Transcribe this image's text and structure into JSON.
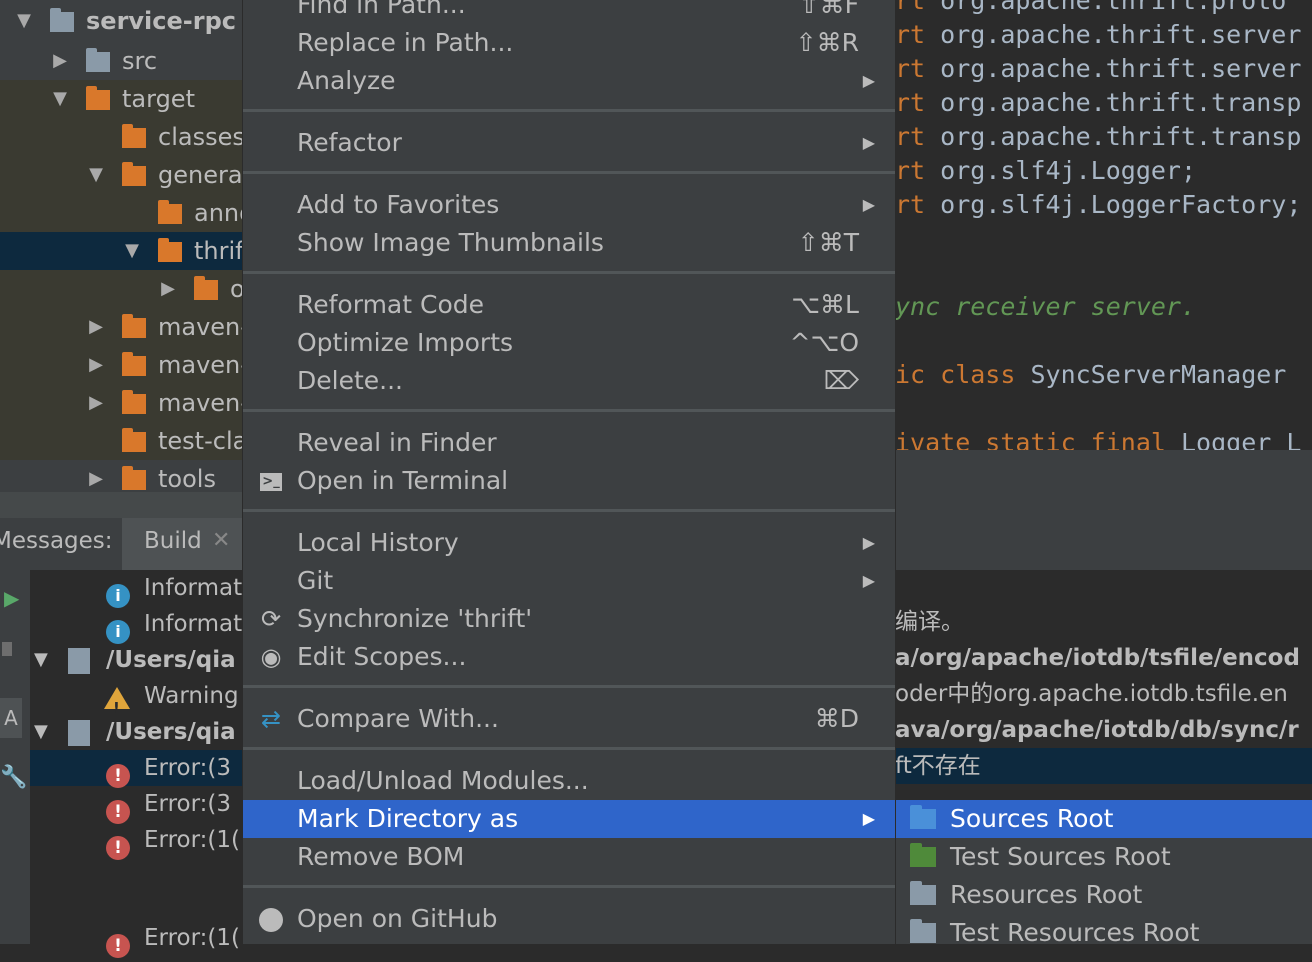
{
  "project_tree": {
    "items": [
      {
        "label": "service-rpc",
        "expanded": true,
        "folder": "module"
      },
      {
        "label": "src",
        "expanded": false,
        "folder": "grey"
      },
      {
        "label": "target",
        "expanded": true,
        "folder": "orange"
      },
      {
        "label": "classes",
        "folder": "orange"
      },
      {
        "label": "genera",
        "expanded": true,
        "folder": "orange"
      },
      {
        "label": "anno",
        "folder": "orange"
      },
      {
        "label": "thrif",
        "expanded": true,
        "folder": "orange",
        "selected": true
      },
      {
        "label": "o",
        "expanded": false,
        "folder": "orange"
      },
      {
        "label": "maven-",
        "expanded": false,
        "folder": "orange"
      },
      {
        "label": "maven-",
        "expanded": false,
        "folder": "orange"
      },
      {
        "label": "maven-",
        "expanded": false,
        "folder": "orange"
      },
      {
        "label": "test-cla",
        "folder": "orange"
      },
      {
        "label": "tools",
        "expanded": false,
        "folder": "orange"
      }
    ]
  },
  "messages_panel": {
    "title": "Messages:",
    "tab": "Build",
    "rows": [
      {
        "type": "info",
        "text": "Informat"
      },
      {
        "type": "info",
        "text": "Informat"
      },
      {
        "type": "file",
        "text": "/Users/qia"
      },
      {
        "type": "warning",
        "text": "Warning"
      },
      {
        "type": "file",
        "text": "/Users/qia"
      },
      {
        "type": "error",
        "text": "Error:(3"
      },
      {
        "type": "error",
        "text": "Error:(3"
      },
      {
        "type": "error",
        "text": "Error:(1("
      },
      {
        "type": "error",
        "text": "Error:(1("
      }
    ]
  },
  "editor": {
    "lines": [
      {
        "kw": "rt",
        "code": " org.apache.thrift.proto"
      },
      {
        "kw": "rt",
        "code": " org.apache.thrift.server"
      },
      {
        "kw": "rt",
        "code": " org.apache.thrift.server"
      },
      {
        "kw": "rt",
        "code": " org.apache.thrift.transp"
      },
      {
        "kw": "rt",
        "code": " org.apache.thrift.transp"
      },
      {
        "kw": "rt",
        "code": " org.slf4j.Logger;"
      },
      {
        "kw": "rt",
        "code": " org.slf4j.LoggerFactory;"
      },
      {
        "comment": "ync receiver server."
      },
      {
        "kw": "ic class",
        "code": " SyncServerManager "
      },
      {
        "kw": "ivate static final",
        "code": " Logger L"
      }
    ]
  },
  "output": {
    "rows": [
      {
        "text": "编译。",
        "bold": false
      },
      {
        "text": "a/org/apache/iotdb/tsfile/encod",
        "bold": true
      },
      {
        "text": "oder中的org.apache.iotdb.tsfile.en",
        "bold": false
      },
      {
        "text": "ava/org/apache/iotdb/db/sync/r",
        "bold": true
      },
      {
        "text": "ft不存在",
        "bold": false,
        "selected": true
      }
    ]
  },
  "context_menu": {
    "items": [
      {
        "label": "Find in Path...",
        "shortcut": "⇧⌘F"
      },
      {
        "label": "Replace in Path...",
        "shortcut": "⇧⌘R"
      },
      {
        "label": "Analyze",
        "submenu": true
      },
      {
        "label": "Refactor",
        "submenu": true
      },
      {
        "label": "Add to Favorites",
        "submenu": true
      },
      {
        "label": "Show Image Thumbnails",
        "shortcut": "⇧⌘T"
      },
      {
        "label": "Reformat Code",
        "shortcut": "⌥⌘L"
      },
      {
        "label": "Optimize Imports",
        "shortcut": "^⌥O"
      },
      {
        "label": "Delete...",
        "shortcut": "⌦"
      },
      {
        "label": "Reveal in Finder"
      },
      {
        "label": "Open in Terminal",
        "icon": "terminal-icon"
      },
      {
        "label": "Local History",
        "submenu": true
      },
      {
        "label": "Git",
        "submenu": true
      },
      {
        "label": "Synchronize 'thrift'",
        "icon": "sync-icon"
      },
      {
        "label": "Edit Scopes...",
        "icon": "scope-icon"
      },
      {
        "label": "Compare With...",
        "shortcut": "⌘D",
        "icon": "compare-icon"
      },
      {
        "label": "Load/Unload Modules..."
      },
      {
        "label": "Mark Directory as",
        "submenu": true,
        "active": true
      },
      {
        "label": "Remove BOM"
      },
      {
        "label": "Open on GitHub",
        "icon": "github-icon"
      }
    ]
  },
  "submenu": {
    "items": [
      {
        "label": "Sources Root",
        "color": "#4a90d9",
        "active": true
      },
      {
        "label": "Test Sources Root",
        "color": "#4f8a3a"
      },
      {
        "label": "Resources Root",
        "color": "#8a9aa8"
      },
      {
        "label": "Test Resources Root",
        "color": "#8a9aa8"
      }
    ]
  },
  "colors": {
    "selection": "#2f65ca",
    "error": "#c75450",
    "info": "#3592c4",
    "warning": "#e0a53b",
    "folder": "#d9782b"
  }
}
